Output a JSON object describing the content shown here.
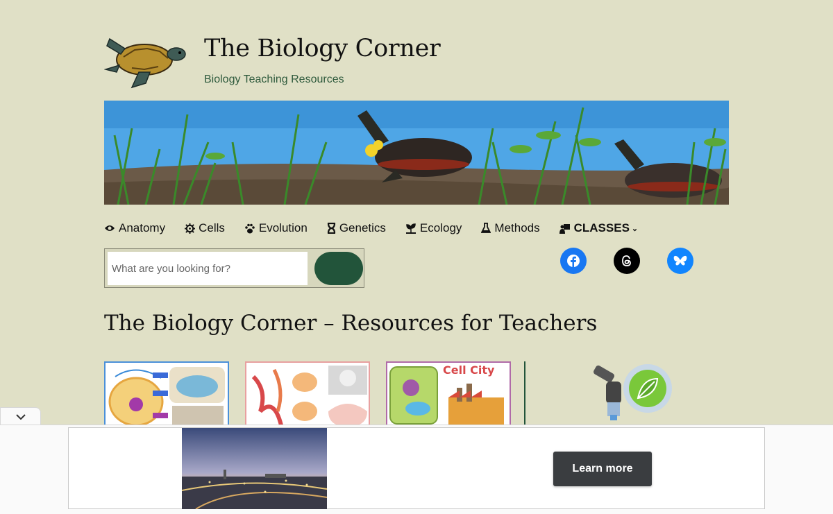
{
  "site": {
    "title": "The Biology Corner",
    "tagline": "Biology Teaching Resources"
  },
  "nav": {
    "items": [
      {
        "label": "Anatomy",
        "icon": "eye-icon"
      },
      {
        "label": "Cells",
        "icon": "virus-icon"
      },
      {
        "label": "Evolution",
        "icon": "paw-icon"
      },
      {
        "label": "Genetics",
        "icon": "hourglass-icon"
      },
      {
        "label": "Ecology",
        "icon": "seedling-icon"
      },
      {
        "label": "Methods",
        "icon": "flask-icon"
      },
      {
        "label": "CLASSES",
        "icon": "teacher-icon"
      }
    ]
  },
  "search": {
    "placeholder": "What are you looking for?"
  },
  "social": [
    "facebook-icon",
    "threads-icon",
    "bluesky-icon"
  ],
  "main": {
    "page_title": "The Biology Corner – Resources for Teachers",
    "card3_text": "Cell City"
  },
  "ad": {
    "cta": "Learn more"
  },
  "colors": {
    "background": "#e0e0c6",
    "accent_green": "#22543a",
    "tagline": "#2e5a3c",
    "facebook": "#1877f2",
    "bluesky": "#1185fe"
  }
}
